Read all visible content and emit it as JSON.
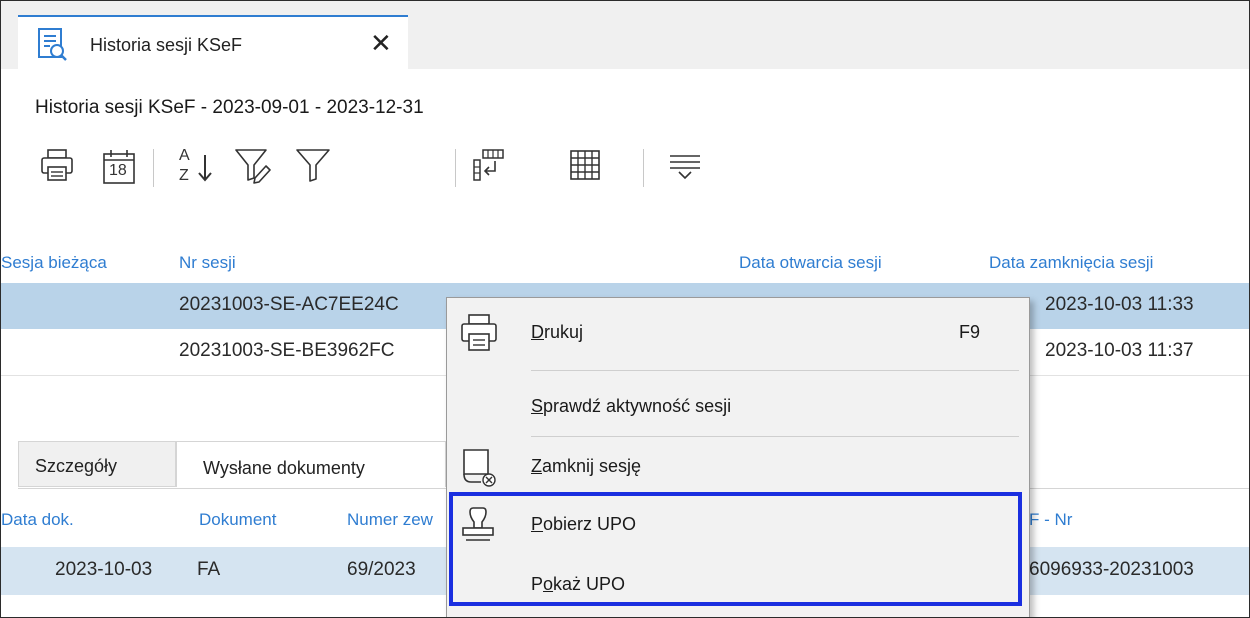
{
  "tab": {
    "title": "Historia sesji KSeF",
    "close": "✕"
  },
  "heading": "Historia sesji KSeF - 2023-09-01 - 2023-12-31",
  "toolbar": {
    "calendar_day": "18",
    "sort_top": "A",
    "sort_bottom": "Z"
  },
  "grid": {
    "columns": {
      "current": "Sesja bieżąca",
      "nr": "Nr sesji",
      "opened": "Data otwarcia sesji",
      "closed": "Data zamknięcia sesji"
    },
    "rows": [
      {
        "nr": "20231003-SE-AC7EE24C",
        "closed": "2023-10-03 11:33"
      },
      {
        "nr": "20231003-SE-BE3962FC",
        "closed": "2023-10-03 11:37"
      }
    ]
  },
  "lower_tabs": {
    "details": "Szczegóły",
    "sent": "Wysłane dokumenty"
  },
  "details_grid": {
    "columns": {
      "date": "Data dok.",
      "doc": "Dokument",
      "number": "Numer zew",
      "ksef": "F - Nr"
    },
    "row": {
      "date": "2023-10-03",
      "doc": "FA",
      "number": "69/2023",
      "ksef": "6096933-20231003"
    }
  },
  "context_menu": {
    "print": {
      "accel": "D",
      "rest": "rukuj",
      "key": "F9"
    },
    "check": {
      "accel": "S",
      "rest": "prawdź aktywność sesji"
    },
    "close": {
      "accel": "Z",
      "rest": "amknij sesję"
    },
    "download": {
      "accel": "P",
      "rest": "obierz UPO"
    },
    "show": {
      "pre": "P",
      "accel": "o",
      "rest": "każ UPO"
    }
  },
  "colors": {
    "accent": "#2f7dd1",
    "selection": "#b9d3e9",
    "highlight_box": "#1a2fe0"
  }
}
